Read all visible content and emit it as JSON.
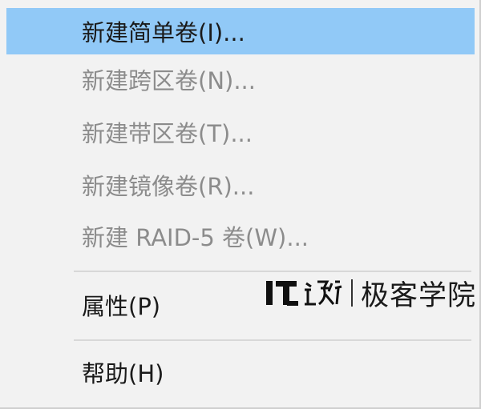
{
  "menu": {
    "items": [
      {
        "label": "新建简单卷(I)...",
        "state": "highlighted"
      },
      {
        "label": "新建跨区卷(N)...",
        "state": "disabled"
      },
      {
        "label": "新建带区卷(T)...",
        "state": "disabled"
      },
      {
        "label": "新建镜像卷(R)...",
        "state": "disabled"
      },
      {
        "label": "新建 RAID-5 卷(W)...",
        "state": "disabled"
      },
      {
        "label": "属性(P)",
        "state": "enabled"
      },
      {
        "label": "帮助(H)",
        "state": "enabled"
      }
    ]
  },
  "watermark": {
    "logo_text": "IT之家",
    "site_name": "极客学院"
  },
  "colors": {
    "highlight": "#91c9f7",
    "menu_background": "#f2f2f2",
    "disabled_text": "#8c8c8c",
    "enabled_text": "#1a1a1a"
  }
}
